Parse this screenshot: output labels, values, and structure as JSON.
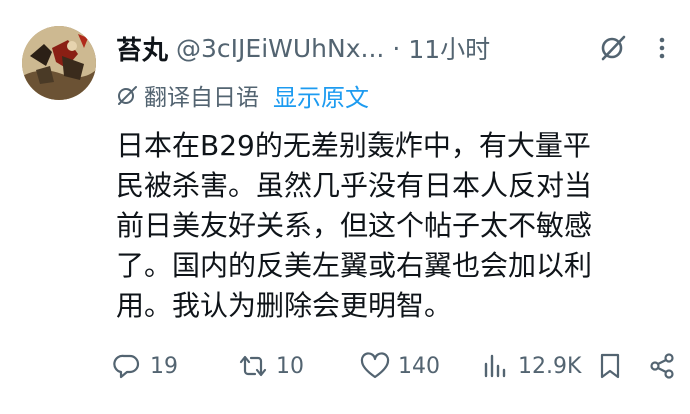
{
  "tweet": {
    "display_name": "苔丸",
    "handle": "@3cIJEiWUhNx...",
    "separator": "·",
    "time": "11小时",
    "translate_label": "翻译自日语",
    "show_original": "显示原文",
    "text_lines": [
      "日本在B29的无差别轰炸中，有大量平",
      "民被杀害。虽然几乎没有日本人反对当",
      "前日美友好关系，但这个帖子太不敏感",
      "了。国内的反美左翼或右翼也会加以利",
      "用。我认为删除会更明智。"
    ],
    "actions": {
      "replies": "19",
      "reposts": "10",
      "likes": "140",
      "views": "12.9K"
    }
  },
  "icons": {
    "avatar": "avatar-painting",
    "grok": "grok-icon",
    "more": "more-vertical-icon",
    "translate": "translate-icon",
    "reply": "reply-icon",
    "repost": "repost-icon",
    "like": "heart-icon",
    "views": "views-icon",
    "bookmark": "bookmark-icon",
    "share": "share-icon"
  },
  "colors": {
    "text": "#0f1419",
    "muted": "#536471",
    "link": "#1d9bf0",
    "background": "#ffffff"
  }
}
